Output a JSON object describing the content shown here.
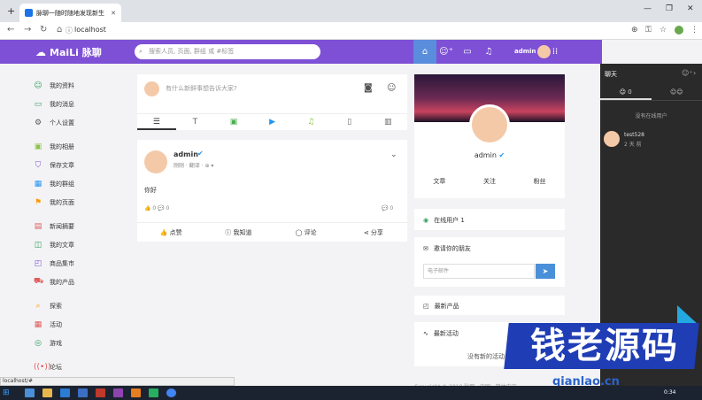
{
  "browser": {
    "tab_title": "脉聊一随时随地发现新生",
    "url": "localhost",
    "status_url": "localhost/#"
  },
  "header": {
    "logo": "MaiLi 脉聊",
    "search_placeholder": "搜索人员, 页面, 群组 或 #标签",
    "username": "admin"
  },
  "sidebar": {
    "items": [
      {
        "label": "我的资料",
        "icon": "person-icon",
        "color": "#2e9e5b"
      },
      {
        "label": "我的消息",
        "icon": "message-icon",
        "color": "#2e9e5b"
      },
      {
        "label": "个人设置",
        "icon": "gear-icon",
        "color": "#555555"
      },
      {
        "label": "我的相册",
        "icon": "image-icon",
        "color": "#8bc34a"
      },
      {
        "label": "保存文章",
        "icon": "bookmark-icon",
        "color": "#7e50d6"
      },
      {
        "label": "我的群组",
        "icon": "grid-icon",
        "color": "#2196f3"
      },
      {
        "label": "我的页面",
        "icon": "page-icon",
        "color": "#ff9800"
      },
      {
        "label": "新闻摘要",
        "icon": "newspaper-icon",
        "color": "#e05a5a"
      },
      {
        "label": "我的文章",
        "icon": "book-icon",
        "color": "#2e9e5b"
      },
      {
        "label": "商品集市",
        "icon": "bag-icon",
        "color": "#7e50d6"
      },
      {
        "label": "我的产品",
        "icon": "cart-icon",
        "color": "#e05a5a"
      },
      {
        "label": "探索",
        "icon": "search-icon",
        "color": "#ff9800"
      },
      {
        "label": "活动",
        "icon": "calendar-icon",
        "color": "#e05a5a"
      },
      {
        "label": "游戏",
        "icon": "gamepad-icon",
        "color": "#2e9e5b"
      },
      {
        "label": "论坛",
        "icon": "broadcast-icon",
        "color": "#e05a5a"
      }
    ]
  },
  "composer": {
    "placeholder": "有什么新鲜事想告诉大家?"
  },
  "post": {
    "author": "admin",
    "meta": "刚刚 · 翻译 · ⊕ ▾",
    "content": "你好",
    "counts": "👍 0   💬 0",
    "comment_count": "💬 0",
    "like": "点赞",
    "know": "我知道",
    "comment": "评论",
    "share": "分享"
  },
  "profile": {
    "name": "admin",
    "actions": [
      "文章",
      "关注",
      "粉丝"
    ]
  },
  "widgets": {
    "online": "在线用户 1",
    "invite": "邀请你的朋友",
    "email_placeholder": "电子邮件",
    "new_products": "最新产品",
    "latest_activity": "最新活动",
    "no_activity": "没有新的活动",
    "copyright": "Copyright © 2019 脉聊 · 中国 · 简体中文"
  },
  "chat": {
    "title": "聊天",
    "tab_online_count": "0",
    "no_online": "没有在线用户",
    "contact_name": "test528",
    "contact_time": "2 天 前"
  },
  "watermark": {
    "text": "钱老源码",
    "url": "qianlao.cn"
  },
  "taskbar": {
    "time": "0:34"
  }
}
